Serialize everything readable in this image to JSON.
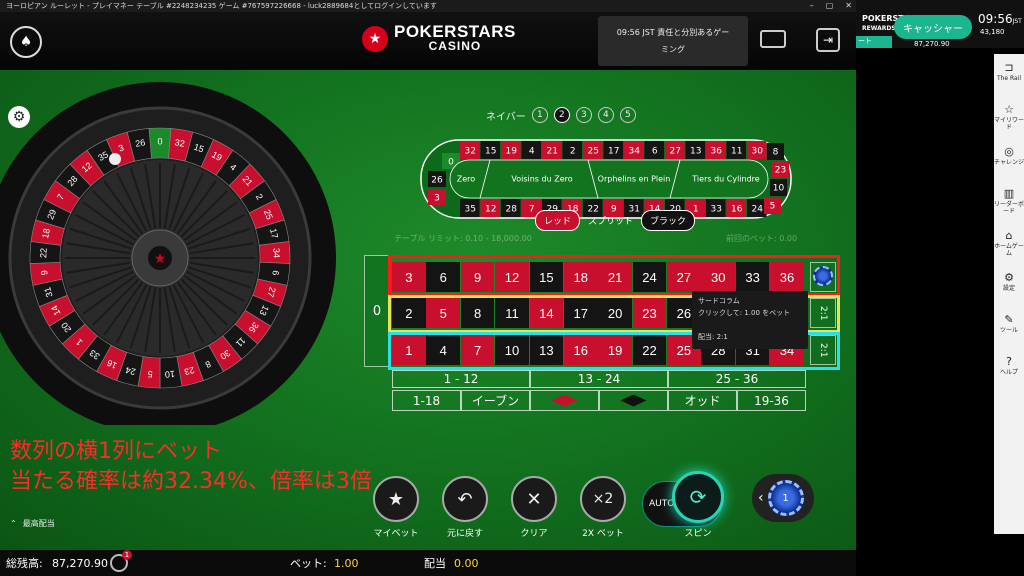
{
  "window": {
    "title": "ヨーロピアン ルーレット - プレイマネー テーブル #2248234235 ゲーム #767597226668 - luck2889684としてログインしています"
  },
  "topbar": {
    "logo_line1": "POKERSTARS",
    "logo_line2": "CASINO",
    "info_line1": "09:56 JST 責任と分別あるゲー",
    "info_line2": "ミング"
  },
  "wheel": {
    "numbers": [
      0,
      32,
      15,
      19,
      4,
      21,
      2,
      25,
      17,
      34,
      6,
      27,
      13,
      36,
      11,
      30,
      8,
      23,
      10,
      5,
      24,
      16,
      33,
      1,
      20,
      14,
      31,
      9,
      22,
      18,
      29,
      7,
      28,
      12,
      35,
      3,
      26
    ],
    "red_numbers": [
      1,
      3,
      5,
      7,
      9,
      12,
      14,
      16,
      18,
      19,
      21,
      23,
      25,
      27,
      30,
      32,
      34,
      36
    ]
  },
  "racetrack": {
    "neighbors_label": "ネイバー",
    "neighbor_options": [
      "1",
      "2",
      "3",
      "4",
      "5"
    ],
    "neighbor_selected": "2",
    "top_row": [
      "32",
      "15",
      "19",
      "4",
      "21",
      "2",
      "25",
      "17",
      "34",
      "6",
      "27",
      "13",
      "36",
      "11",
      "30"
    ],
    "bottom_row": [
      "35",
      "12",
      "28",
      "7",
      "29",
      "18",
      "22",
      "9",
      "31",
      "14",
      "20",
      "1",
      "33",
      "16",
      "24"
    ],
    "left_end": [
      "0",
      "26",
      "3"
    ],
    "right_end": [
      "8",
      "23",
      "10",
      "5"
    ],
    "sections": [
      "Zero",
      "Voisins du Zero",
      "Orphelins en Plein",
      "Tiers du Cylindre"
    ]
  },
  "toggle": {
    "red": "レッド",
    "split": "スプリット",
    "black": "ブラック"
  },
  "table": {
    "limit_label": "テーブル リミット: 0.10 - 18,000.00",
    "prev_bet_label": "前回のベット: 0.00",
    "zero": "0",
    "row_top": [
      "3",
      "6",
      "9",
      "12",
      "15",
      "18",
      "21",
      "24",
      "27",
      "30",
      "33",
      "36"
    ],
    "row_mid": [
      "2",
      "5",
      "8",
      "11",
      "14",
      "17",
      "20",
      "23",
      "26",
      "29",
      "32",
      "35"
    ],
    "row_bot": [
      "1",
      "4",
      "7",
      "10",
      "13",
      "16",
      "19",
      "22",
      "25",
      "28",
      "31",
      "34"
    ],
    "column_label": "2:1",
    "dozens": [
      "1 - 12",
      "13 - 24",
      "25 - 36"
    ],
    "evens": [
      "1-18",
      "イーブン",
      "",
      "",
      "オッド",
      "19-36"
    ]
  },
  "tooltip": {
    "title": "サードコラム",
    "line1": "クリックして: 1.00 をベット",
    "line2": "配当: 2:1"
  },
  "overlay": {
    "line1": "数列の横1列にベット",
    "line2": "当たる確率は約32.34%、倍率は3倍"
  },
  "controls": {
    "max_payout": "最高配当",
    "my_bet": "マイベット",
    "undo": "元に戻す",
    "clear": "クリア",
    "double": "2X ベット",
    "auto": "AUTO",
    "spin": "スピン",
    "chip_value": "1"
  },
  "bottombar": {
    "balance_label": "総残高:",
    "balance": "87,270.90",
    "bet_label": "ベット:",
    "bet": "1.00",
    "payout_label": "配当",
    "payout": "0.00",
    "notif_count": "1"
  },
  "side": {
    "brand": "POKERSTARS",
    "brand_sub": "REWARDS",
    "cashier": "キャッシャー",
    "balance": "87,270.90",
    "time": "09:56",
    "tz": "JST",
    "user_count": "43,180",
    "tab": "ート",
    "items": [
      {
        "icon": "rail-icon",
        "glyph": "⊐",
        "label": "The Rail"
      },
      {
        "icon": "reward-icon",
        "glyph": "☆",
        "label": "マイリワード"
      },
      {
        "icon": "challenge-icon",
        "glyph": "◎",
        "label": "チャレンジ"
      },
      {
        "icon": "leaderboard-icon",
        "glyph": "▥",
        "label": "リーダーボード"
      },
      {
        "icon": "home-icon",
        "glyph": "⌂",
        "label": "ホームゲーム"
      },
      {
        "icon": "gear-icon",
        "glyph": "⚙",
        "label": "設定"
      },
      {
        "icon": "tools-icon",
        "glyph": "✎",
        "label": "ツール"
      },
      {
        "icon": "help-icon",
        "glyph": "?",
        "label": "ヘルプ"
      }
    ]
  },
  "colors": {
    "felt": "#137420",
    "red": "#c8102e",
    "black": "#141414",
    "accent": "#1bb58f",
    "spin": "#22d6b7"
  }
}
